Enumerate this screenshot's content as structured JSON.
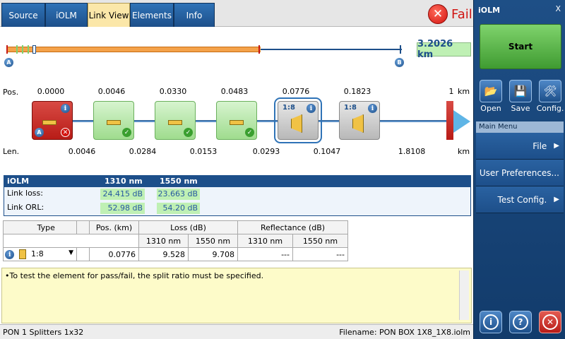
{
  "tabs": [
    {
      "label": "Source",
      "active": false
    },
    {
      "label": "iOLM",
      "active": false
    },
    {
      "label": "Link View",
      "active": true
    },
    {
      "label": "Elements",
      "active": false
    },
    {
      "label": "Info",
      "active": false
    }
  ],
  "verdict": {
    "label": "Fail",
    "icon": "fail-x-icon",
    "color": "#d3140f"
  },
  "span": {
    "total_length": "3.2026 km",
    "marker_a": "A",
    "marker_b": "B"
  },
  "positions": {
    "label": "Pos.",
    "unit": "km",
    "values": [
      "0.0000",
      "0.0046",
      "0.0330",
      "0.0483",
      "0.0776",
      "0.1823",
      "1"
    ]
  },
  "lengths": {
    "label": "Len.",
    "unit": "km",
    "values": [
      "0.0046",
      "0.0284",
      "0.0153",
      "0.0293",
      "0.1047",
      "1.8108"
    ]
  },
  "elements": [
    {
      "type": "launch",
      "status": "fail",
      "badge": "A"
    },
    {
      "type": "connector",
      "status": "pass"
    },
    {
      "type": "connector",
      "status": "pass"
    },
    {
      "type": "connector",
      "status": "pass"
    },
    {
      "type": "splitter",
      "ratio": "1:8",
      "status": "unknown",
      "selected": true
    },
    {
      "type": "splitter",
      "ratio": "1:8",
      "status": "unknown",
      "selected": false
    }
  ],
  "summary": {
    "title": "iOLM",
    "col1": "1310 nm",
    "col2": "1550 nm",
    "rows": [
      {
        "label": "Link loss:",
        "v1": "24.415 dB",
        "v2": "23.663 dB"
      },
      {
        "label": "Link ORL:",
        "v1": "52.98 dB",
        "v2": "54.20 dB"
      }
    ]
  },
  "detail": {
    "headers": {
      "type": "Type",
      "pos": "Pos. (km)",
      "loss": "Loss (dB)",
      "refl": "Reflectance (dB)"
    },
    "sub": {
      "l1310": "1310 nm",
      "l1550": "1550 nm",
      "r1310": "1310 nm",
      "r1550": "1550 nm"
    },
    "row": {
      "type": "1:8",
      "pos": "0.0776",
      "l1310": "9.528",
      "l1550": "9.708",
      "r1310": "---",
      "r1550": "---"
    }
  },
  "note": "•To test the element for pass/fail, the split ratio must be specified.",
  "status": {
    "left": "PON 1 Splitters 1x32",
    "right": "Filename: PON BOX 1X8_1X8.iolm"
  },
  "side": {
    "title": "iOLM",
    "close": "X",
    "start": "Start",
    "tools": [
      {
        "label": "Open",
        "icon": "folder-open-icon"
      },
      {
        "label": "Save",
        "icon": "floppy-disk-icon"
      },
      {
        "label": "Config.",
        "icon": "tools-icon"
      }
    ],
    "menu_header": "Main Menu",
    "menu": [
      {
        "label": "File",
        "arrow": "▶"
      },
      {
        "label": "User Preferences...",
        "arrow": ""
      },
      {
        "label": "Test Config.",
        "arrow": "▶"
      }
    ]
  }
}
